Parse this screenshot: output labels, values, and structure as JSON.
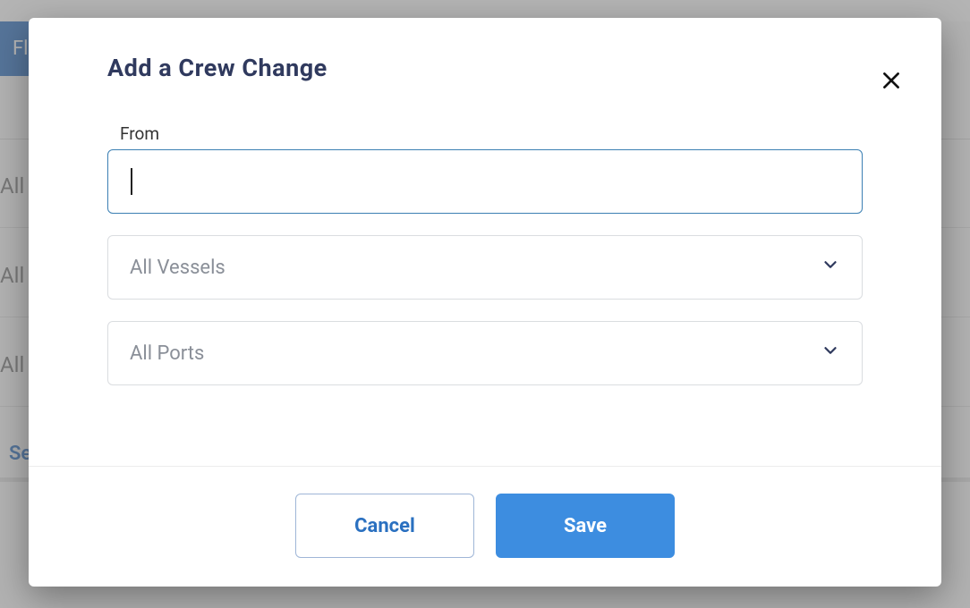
{
  "bg": {
    "fla_label": "Fla",
    "row1": "All V",
    "row2": "All E",
    "row3": "All S",
    "link": "Se"
  },
  "modal": {
    "title": "Add a Crew Change",
    "from_label": "From",
    "from_value": "",
    "vessel_selected": "All Vessels",
    "port_selected": "All Ports",
    "cancel": "Cancel",
    "save": "Save"
  }
}
